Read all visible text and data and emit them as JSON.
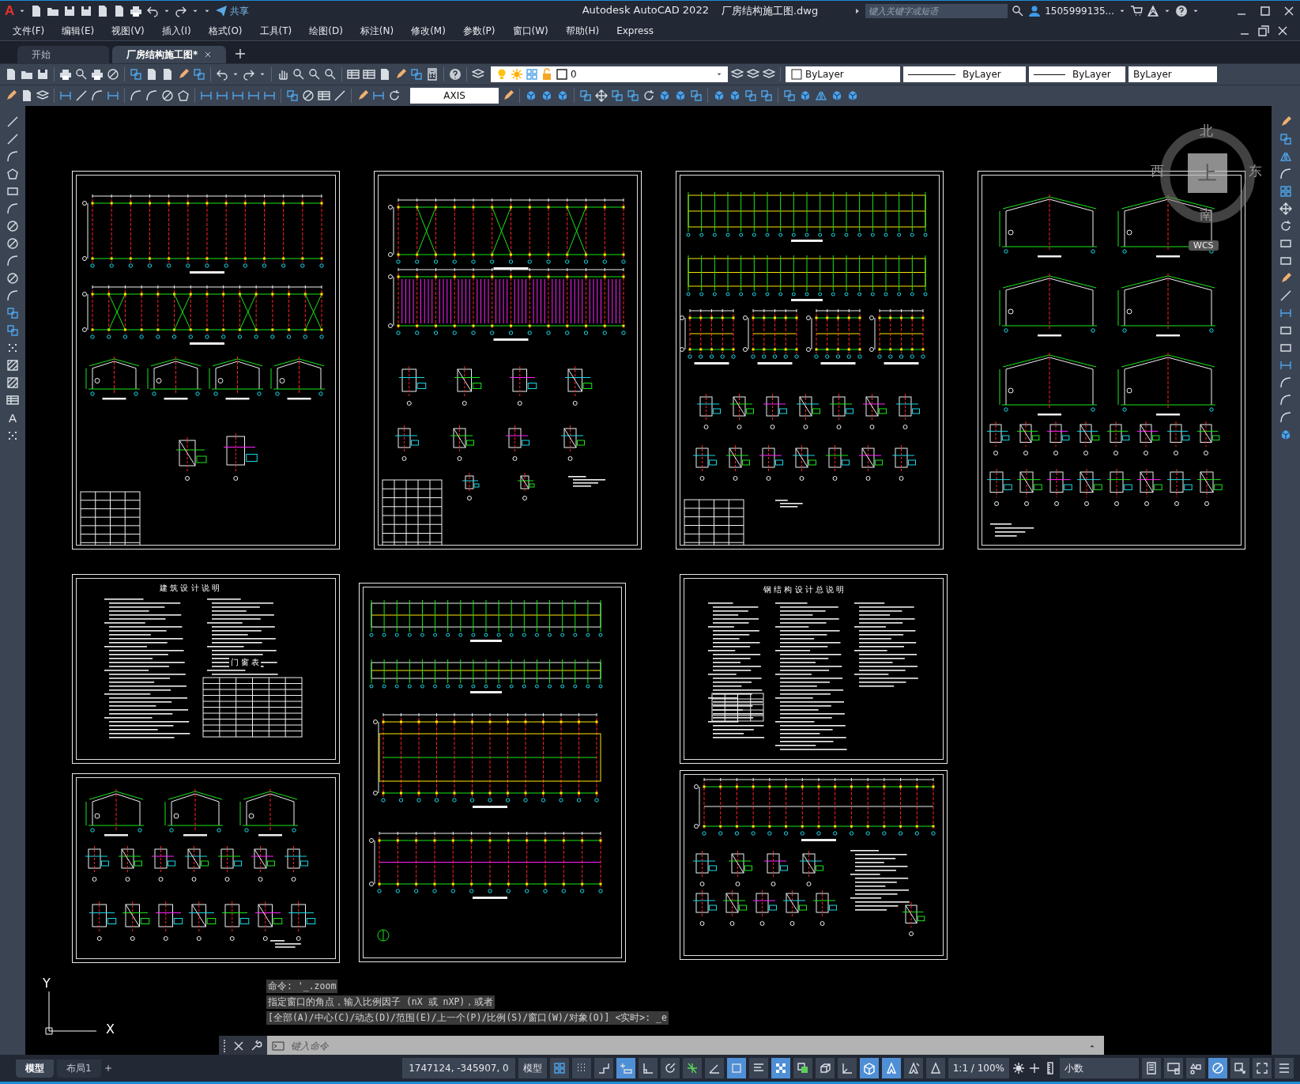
{
  "title_bar": {
    "app_letter": "A",
    "share": "共享",
    "title": "Autodesk AutoCAD 2022",
    "file": "厂房结构施工图.dwg",
    "search": {
      "placeholder": "键入关键字或短语"
    },
    "user": "1505999135..."
  },
  "menu": [
    "文件(F)",
    "编辑(E)",
    "视图(V)",
    "插入(I)",
    "格式(O)",
    "工具(T)",
    "绘图(D)",
    "标注(N)",
    "修改(M)",
    "参数(P)",
    "窗口(W)",
    "帮助(H)",
    "Express"
  ],
  "doc_tabs": [
    {
      "label": "开始",
      "selected": false
    },
    {
      "label": "厂房结构施工图*",
      "selected": true
    }
  ],
  "properties": {
    "layer": "0",
    "color_setting": "ByLayer",
    "linetype": "ByLayer",
    "lineweight": "ByLayer",
    "plot_style": "ByLayer"
  },
  "dim_style": "AXIS",
  "draw_toolbar": {
    "text_tool": "A"
  },
  "sheets": [
    {
      "kind": "plan"
    },
    {
      "kind": "framing"
    },
    {
      "kind": "elevation"
    },
    {
      "kind": "frames"
    },
    {
      "kind": "notes",
      "title": "建 筑 设 计 说 明",
      "table_title": "门 窗 表"
    },
    {
      "kind": "sections"
    },
    {
      "kind": "spec",
      "title": "钢 结 构 设 计 总 说 明"
    },
    {
      "kind": "details"
    },
    {
      "kind": "foundation"
    }
  ],
  "viewcube": {
    "north": "北",
    "south": "南",
    "east": "东",
    "west": "西",
    "face": "上",
    "wcs": "WCS"
  },
  "ucs": {
    "x": "X",
    "y": "Y"
  },
  "command": {
    "history": [
      "命令: '_.zoom",
      "指定窗口的角点，输入比例因子 (nX 或 nXP)，或者",
      "[全部(A)/中心(C)/动态(D)/范围(E)/上一个(P)/比例(S)/窗口(W)/对象(O)] <实时>: _e"
    ],
    "placeholder": "键入命令"
  },
  "layout_tabs": [
    {
      "label": "模型",
      "selected": true
    },
    {
      "label": "布局1",
      "selected": false
    }
  ],
  "status": {
    "coords": "1747124, -345907, 0",
    "space": "模型",
    "scale": "1:1 / 100%",
    "units": "小数"
  },
  "status_toggles": [
    {
      "kind": "grid",
      "on": false
    },
    {
      "kind": "snap",
      "on": false
    },
    {
      "kind": "infer",
      "on": false
    },
    {
      "kind": "dynamic",
      "on": true
    },
    {
      "kind": "ortho",
      "on": false
    },
    {
      "kind": "polar",
      "on": false
    },
    {
      "kind": "tracking",
      "on": false
    },
    {
      "kind": "angle",
      "on": false
    },
    {
      "kind": "osnap",
      "on": true
    },
    {
      "kind": "lineweight",
      "on": false
    },
    {
      "kind": "transparency",
      "on": true
    },
    {
      "kind": "cycling",
      "on": false
    },
    {
      "kind": "osnap3d",
      "on": false
    },
    {
      "kind": "ucs",
      "on": false
    },
    {
      "kind": "gizmo",
      "on": true
    },
    {
      "kind": "annovis",
      "on": true
    },
    {
      "kind": "autoscale",
      "on": false
    },
    {
      "kind": "annoscale",
      "on": false
    }
  ],
  "status_tail": [
    {
      "kind": "properties",
      "on": false
    },
    {
      "kind": "workspace",
      "on": false
    },
    {
      "kind": "isolate",
      "on": false
    },
    {
      "kind": "hardware",
      "on": true
    },
    {
      "kind": "annomonitor",
      "on": false
    },
    {
      "kind": "fullscreen",
      "on": false
    },
    {
      "kind": "menu",
      "on": false
    }
  ]
}
